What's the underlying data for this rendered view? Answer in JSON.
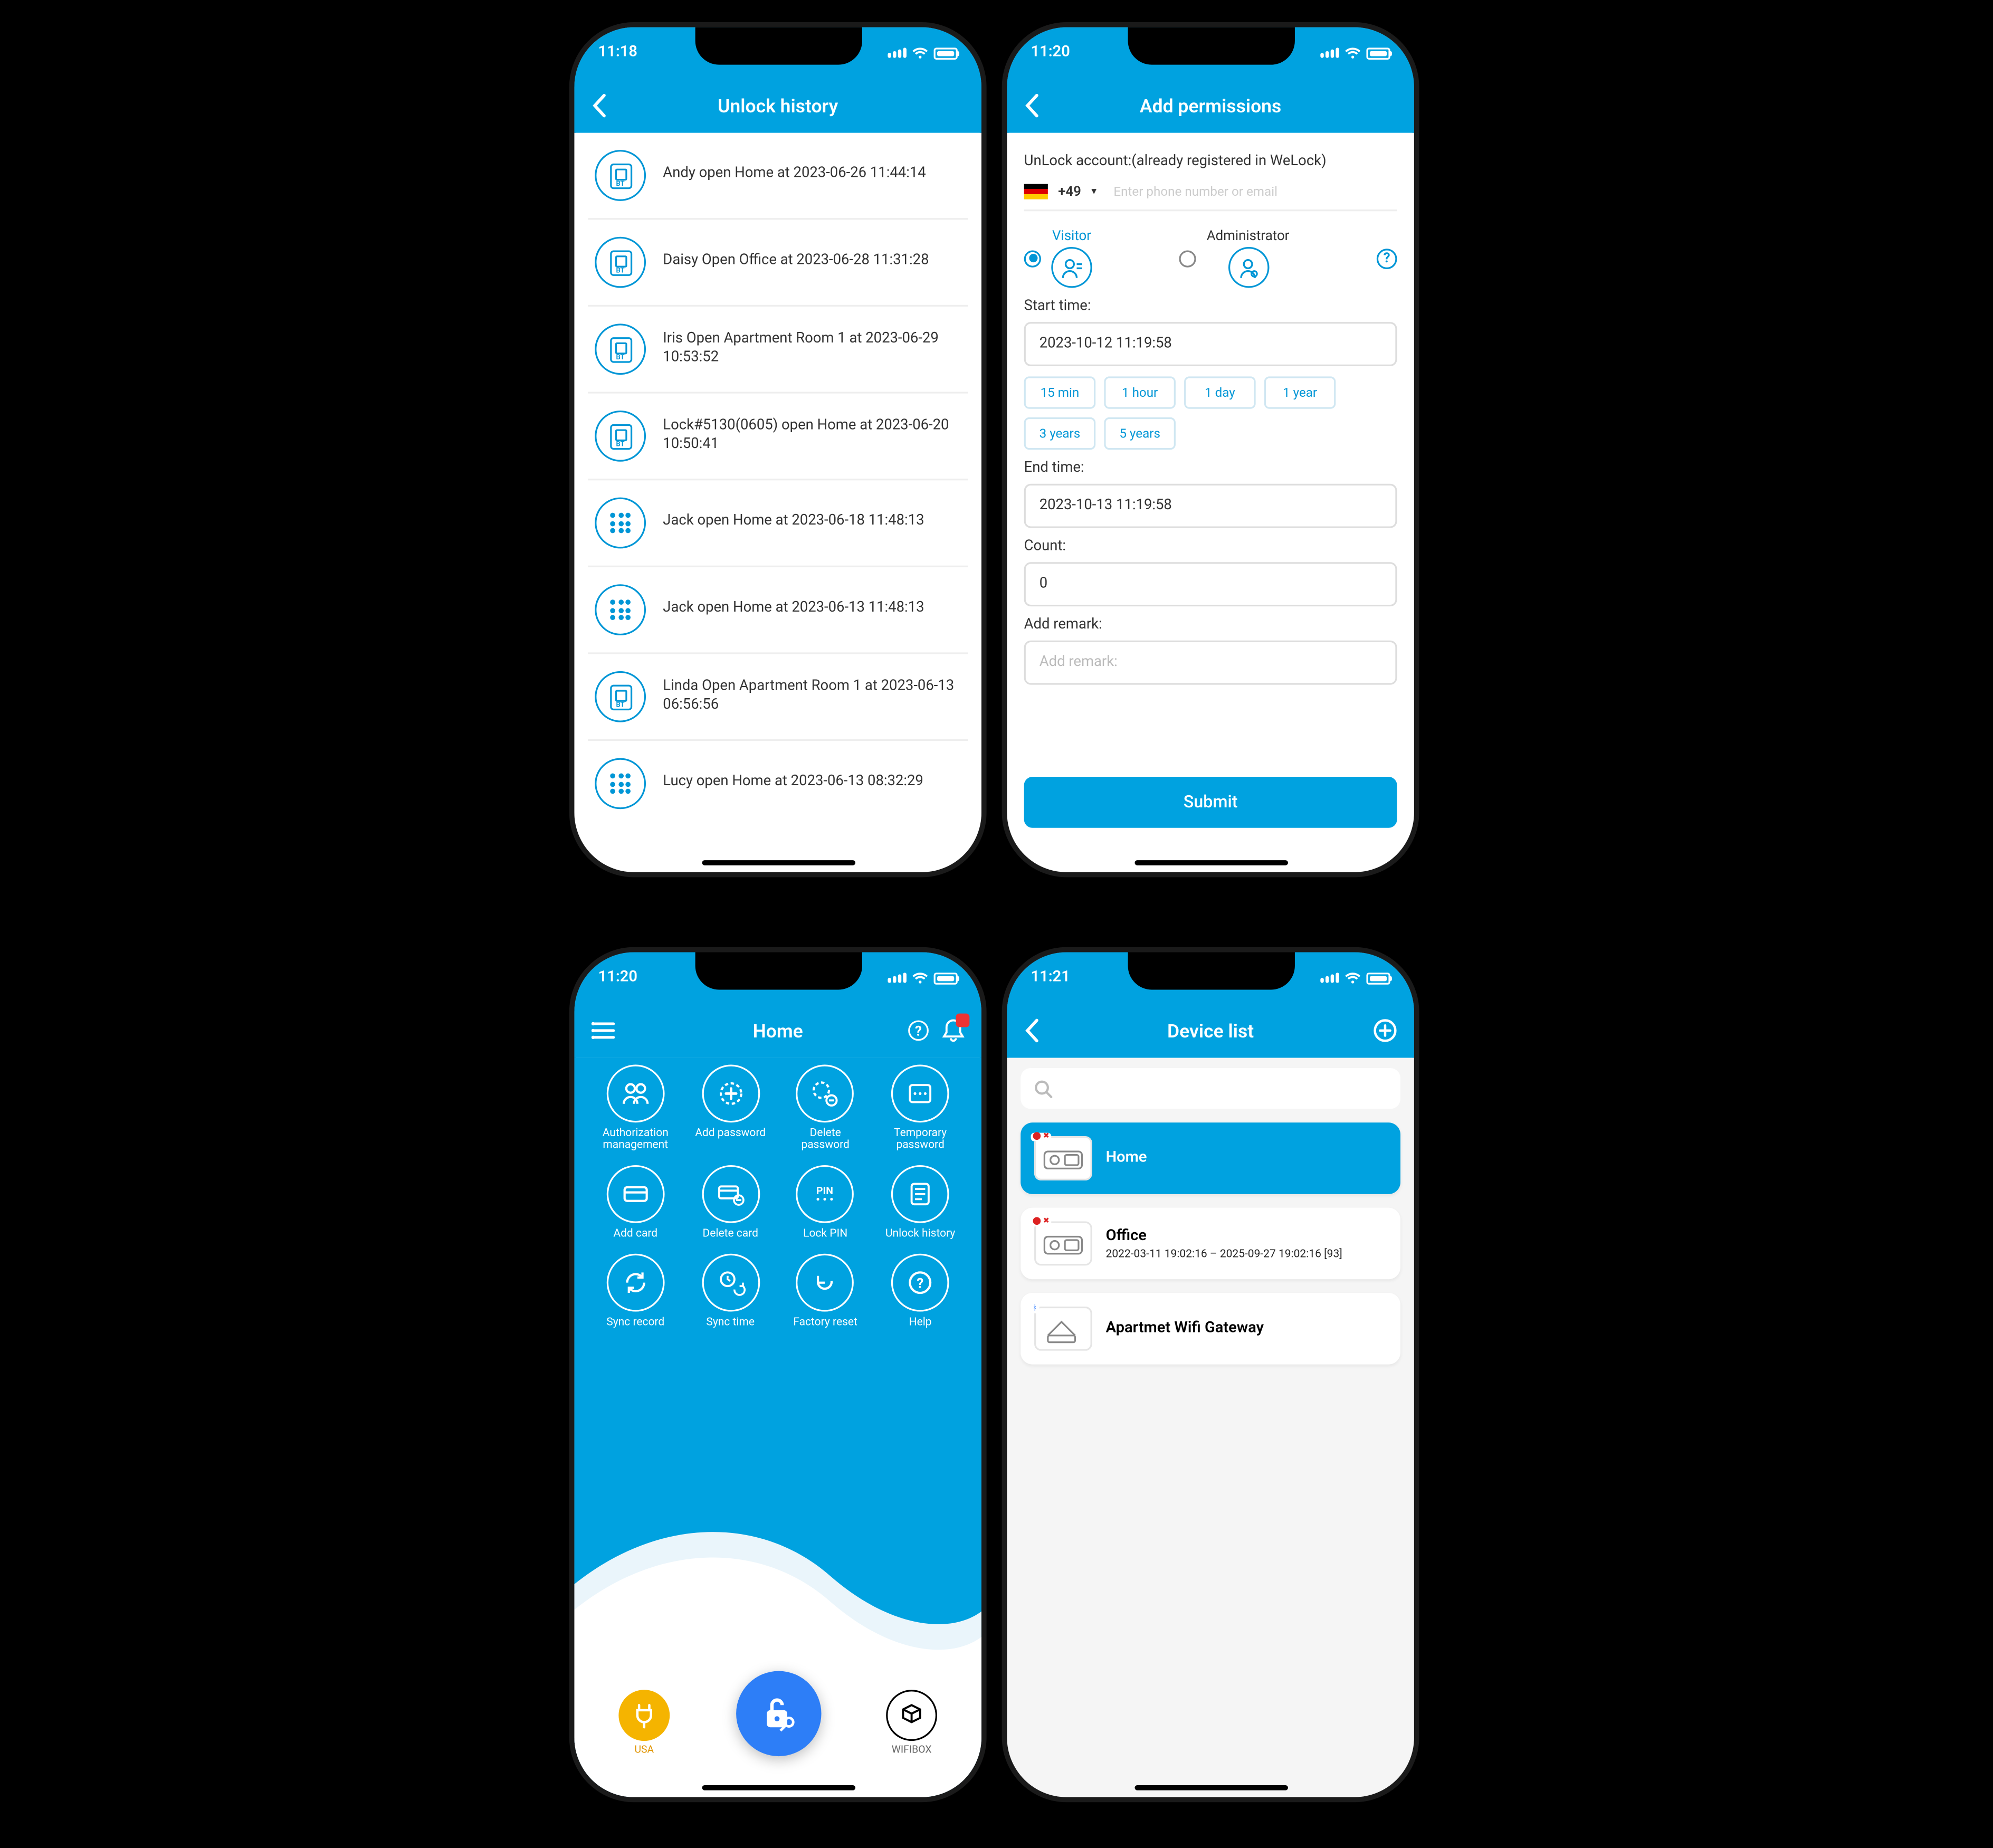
{
  "phone1": {
    "time": "11:18",
    "title": "Unlock history",
    "items": [
      {
        "icon": "device",
        "text": "Andy open Home at 2023-06-26 11:44:14"
      },
      {
        "icon": "device",
        "text": "Daisy Open Office at 2023-06-28 11:31:28"
      },
      {
        "icon": "device",
        "text": "Iris Open Apartment Room 1 at 2023-06-29 10:53:52"
      },
      {
        "icon": "device",
        "text": "Lock#5130(0605) open Home at 2023-06-20 10:50:41"
      },
      {
        "icon": "keypad",
        "text": "Jack open Home at 2023-06-18 11:48:13"
      },
      {
        "icon": "keypad",
        "text": "Jack open Home at 2023-06-13 11:48:13"
      },
      {
        "icon": "device",
        "text": "Linda Open Apartment Room 1 at 2023-06-13 06:56:56"
      },
      {
        "icon": "keypad",
        "text": "Lucy open Home at 2023-06-13 08:32:29"
      }
    ]
  },
  "phone2": {
    "time": "11:20",
    "title": "Add permissions",
    "account_label": "UnLock account:(already registered in WeLock)",
    "country_code": "+49",
    "phone_placeholder": "Enter phone number or email",
    "role_visitor": "Visitor",
    "role_admin": "Administrator",
    "start_label": "Start time:",
    "start_value": "2023-10-12 11:19:58",
    "durations": [
      "15 min",
      "1 hour",
      "1 day",
      "1 year",
      "3 years",
      "5 years"
    ],
    "end_label": "End time:",
    "end_value": "2023-10-13 11:19:58",
    "count_label": "Count:",
    "count_value": "0",
    "remark_label": "Add remark:",
    "remark_placeholder": "Add remark:",
    "submit": "Submit"
  },
  "phone3": {
    "time": "11:20",
    "title": "Home",
    "grid": [
      {
        "icon": "auth",
        "label": "Authorization management"
      },
      {
        "icon": "addpwd",
        "label": "Add password"
      },
      {
        "icon": "delpwd",
        "label": "Delete password"
      },
      {
        "icon": "temppwd",
        "label": "Temporary password"
      },
      {
        "icon": "addcard",
        "label": "Add card"
      },
      {
        "icon": "delcard",
        "label": "Delete card"
      },
      {
        "icon": "lockpin",
        "label": "Lock PIN"
      },
      {
        "icon": "history",
        "label": "Unlock history"
      },
      {
        "icon": "syncrec",
        "label": "Sync record"
      },
      {
        "icon": "synctime",
        "label": "Sync time"
      },
      {
        "icon": "reset",
        "label": "Factory reset"
      },
      {
        "icon": "help",
        "label": "Help"
      }
    ],
    "bottom": {
      "left": "USA",
      "right": "WIFIBOX"
    }
  },
  "phone4": {
    "time": "11:21",
    "title": "Device list",
    "devices": [
      {
        "name": "Home",
        "selected": true,
        "badge": "red"
      },
      {
        "name": "Office",
        "sub": "2022-03-11 19:02:16 – 2025-09-27 19:02:16 [93]",
        "badge": "red"
      },
      {
        "name": "Apartmet Wifi Gateway",
        "badge": "blue"
      }
    ]
  }
}
